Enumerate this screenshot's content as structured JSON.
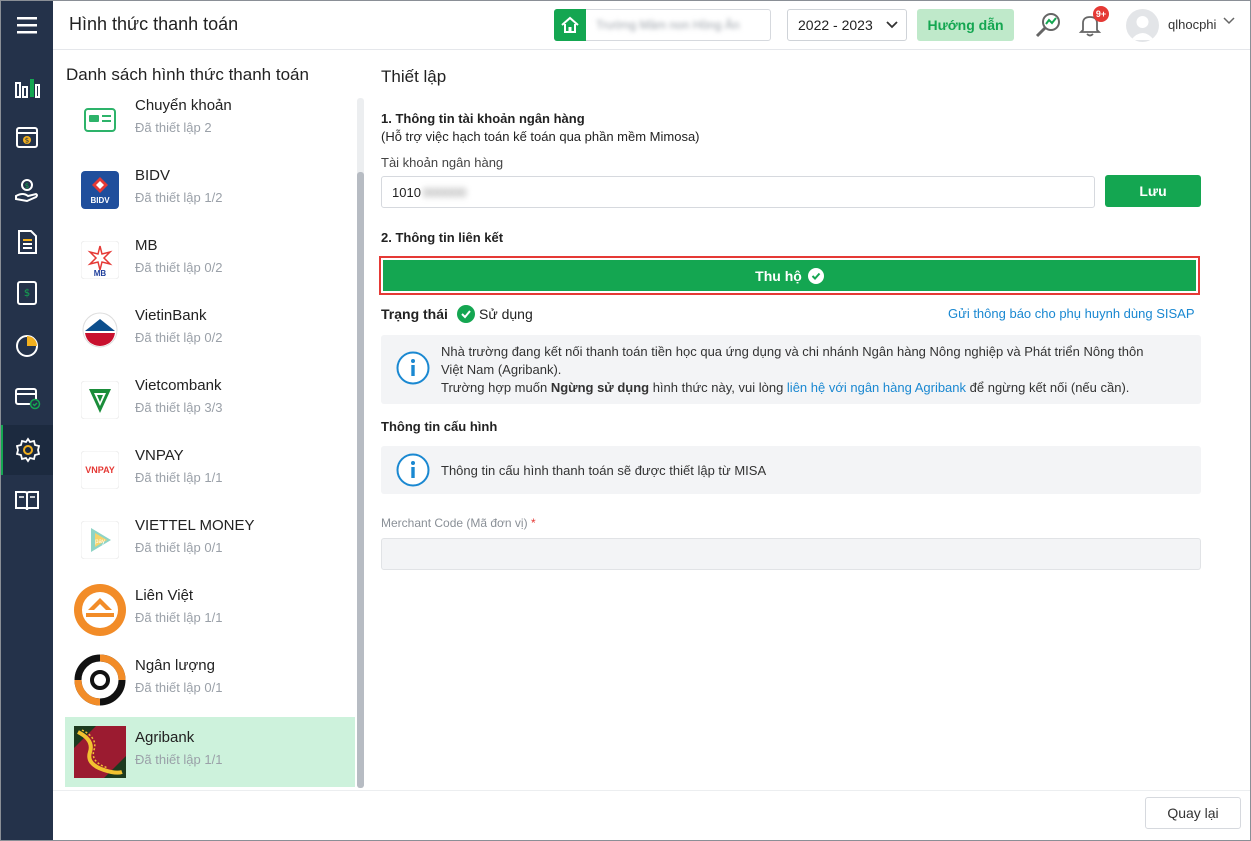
{
  "header": {
    "title": "Hình thức thanh toán",
    "school_name": "Trường Mầm non Hồng Ân",
    "year": "2022 - 2023",
    "guide_label": "Hướng dẫn",
    "notification_count": "9+",
    "username": "qlhocphi"
  },
  "sidebar": {
    "items": [
      {
        "icon": "chart-icon"
      },
      {
        "icon": "calendar-money-icon"
      },
      {
        "icon": "hand-money-icon"
      },
      {
        "icon": "document-icon"
      },
      {
        "icon": "ledger-icon"
      },
      {
        "icon": "pie-chart-icon"
      },
      {
        "icon": "card-check-icon"
      },
      {
        "icon": "gear-icon"
      },
      {
        "icon": "book-icon"
      }
    ],
    "active_index": 7
  },
  "list": {
    "title": "Danh sách hình thức thanh toán",
    "items": [
      {
        "name": "Chuyển khoản",
        "status": "Đã thiết lập 2"
      },
      {
        "name": "BIDV",
        "status": "Đã thiết lập 1/2"
      },
      {
        "name": "MB",
        "status": "Đã thiết lập 0/2"
      },
      {
        "name": "VietinBank",
        "status": "Đã thiết lập 0/2"
      },
      {
        "name": "Vietcombank",
        "status": "Đã thiết lập 3/3"
      },
      {
        "name": "VNPAY",
        "status": "Đã thiết lập 1/1"
      },
      {
        "name": "VIETTEL MONEY",
        "status": "Đã thiết lập 0/1"
      },
      {
        "name": "Liên Việt",
        "status": "Đã thiết lập 1/1"
      },
      {
        "name": "Ngân lượng",
        "status": "Đã thiết lập 0/1"
      },
      {
        "name": "Agribank",
        "status": "Đã thiết lập 1/1"
      }
    ],
    "selected": "Agribank"
  },
  "settings": {
    "title": "Thiết lập",
    "section1_title": "1. Thông tin tài khoản ngân hàng",
    "section1_note": "(Hỗ trợ việc hạch toán kế toán qua phần mềm Mimosa)",
    "account_label": "Tài khoản ngân hàng",
    "account_value": "1010",
    "account_hidden": "000000",
    "save_label": "Lưu",
    "section2_title": "2. Thông tin liên kết",
    "collect_label": "Thu hộ",
    "status_label": "Trạng thái",
    "status_value": "Sử dụng",
    "notify_link": "Gửi thông báo cho phụ huynh dùng SISAP",
    "info1_line1": "Nhà trường đang kết nối thanh toán tiền học qua ứng dụng và chi nhánh Ngân hàng Nông nghiệp và Phát triển Nông thôn",
    "info1_line2": "Việt Nam (Agribank).",
    "info1_line3_a": "Trường hợp muốn ",
    "info1_line3_bold": "Ngừng sử dụng",
    "info1_line3_b": " hình thức này, vui lòng ",
    "info1_line3_link": "liên hệ với ngân hàng Agribank",
    "info1_line3_c": " để ngừng kết nối (nếu cần).",
    "config_title": "Thông tin cấu hình",
    "info2": "Thông tin cấu hình thanh toán sẽ được thiết lập từ MISA",
    "merchant_label": "Merchant Code (Mã đơn vị)",
    "merchant_required": "*",
    "merchant_value": ""
  },
  "footer": {
    "back_label": "Quay lại"
  },
  "colors": {
    "sidebar_bg": "#24324a",
    "primary_green": "#14a651",
    "selected_bg": "#cdf2dc",
    "link_blue": "#1a88d1",
    "highlight_red": "#e53935"
  }
}
